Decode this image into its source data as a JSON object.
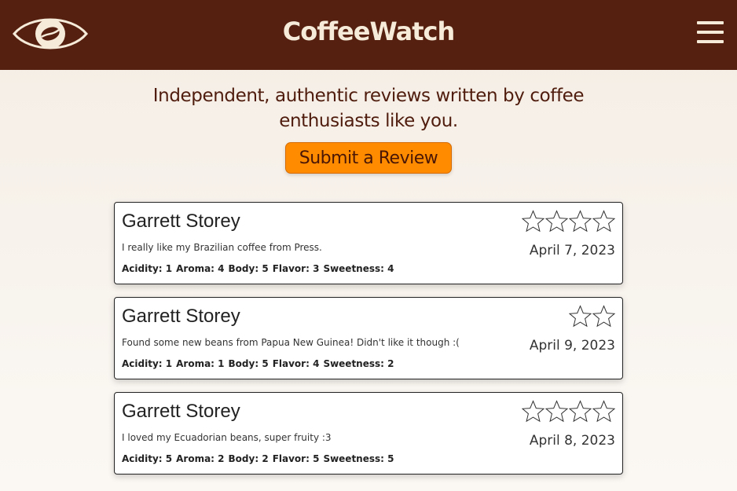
{
  "header": {
    "brand": "CoffeeWatch",
    "logo_icon": "eye-coffee-bean-icon",
    "menu_icon": "hamburger-menu-icon"
  },
  "hero": {
    "tagline": "Independent, authentic reviews written by coffee enthusiasts like you.",
    "submit_label": "Submit a Review"
  },
  "colors": {
    "header_bg": "#55200f",
    "brand_text": "#f6ead8",
    "accent": "#ff8c00"
  },
  "reviews": [
    {
      "author": "Garrett Storey",
      "body": "I really like my Brazilian coffee from Press.",
      "date": "April 7, 2023",
      "stars": 4,
      "metrics": [
        {
          "label": "Acidity:",
          "value": "1"
        },
        {
          "label": "Aroma:",
          "value": "4"
        },
        {
          "label": "Body:",
          "value": "5"
        },
        {
          "label": "Flavor:",
          "value": "3"
        },
        {
          "label": "Sweetness:",
          "value": "4"
        }
      ]
    },
    {
      "author": "Garrett Storey",
      "body": "Found some new beans from Papua New Guinea! Didn't like it though :(",
      "date": "April 9, 2023",
      "stars": 2,
      "metrics": [
        {
          "label": "Acidity:",
          "value": "1"
        },
        {
          "label": "Aroma:",
          "value": "1"
        },
        {
          "label": "Body:",
          "value": "5"
        },
        {
          "label": "Flavor:",
          "value": "4"
        },
        {
          "label": "Sweetness:",
          "value": "2"
        }
      ]
    },
    {
      "author": "Garrett Storey",
      "body": "I loved my Ecuadorian beans, super fruity :3",
      "date": "April 8, 2023",
      "stars": 4,
      "metrics": [
        {
          "label": "Acidity:",
          "value": "5"
        },
        {
          "label": "Aroma:",
          "value": "2"
        },
        {
          "label": "Body:",
          "value": "2"
        },
        {
          "label": "Flavor:",
          "value": "5"
        },
        {
          "label": "Sweetness:",
          "value": "5"
        }
      ]
    }
  ]
}
